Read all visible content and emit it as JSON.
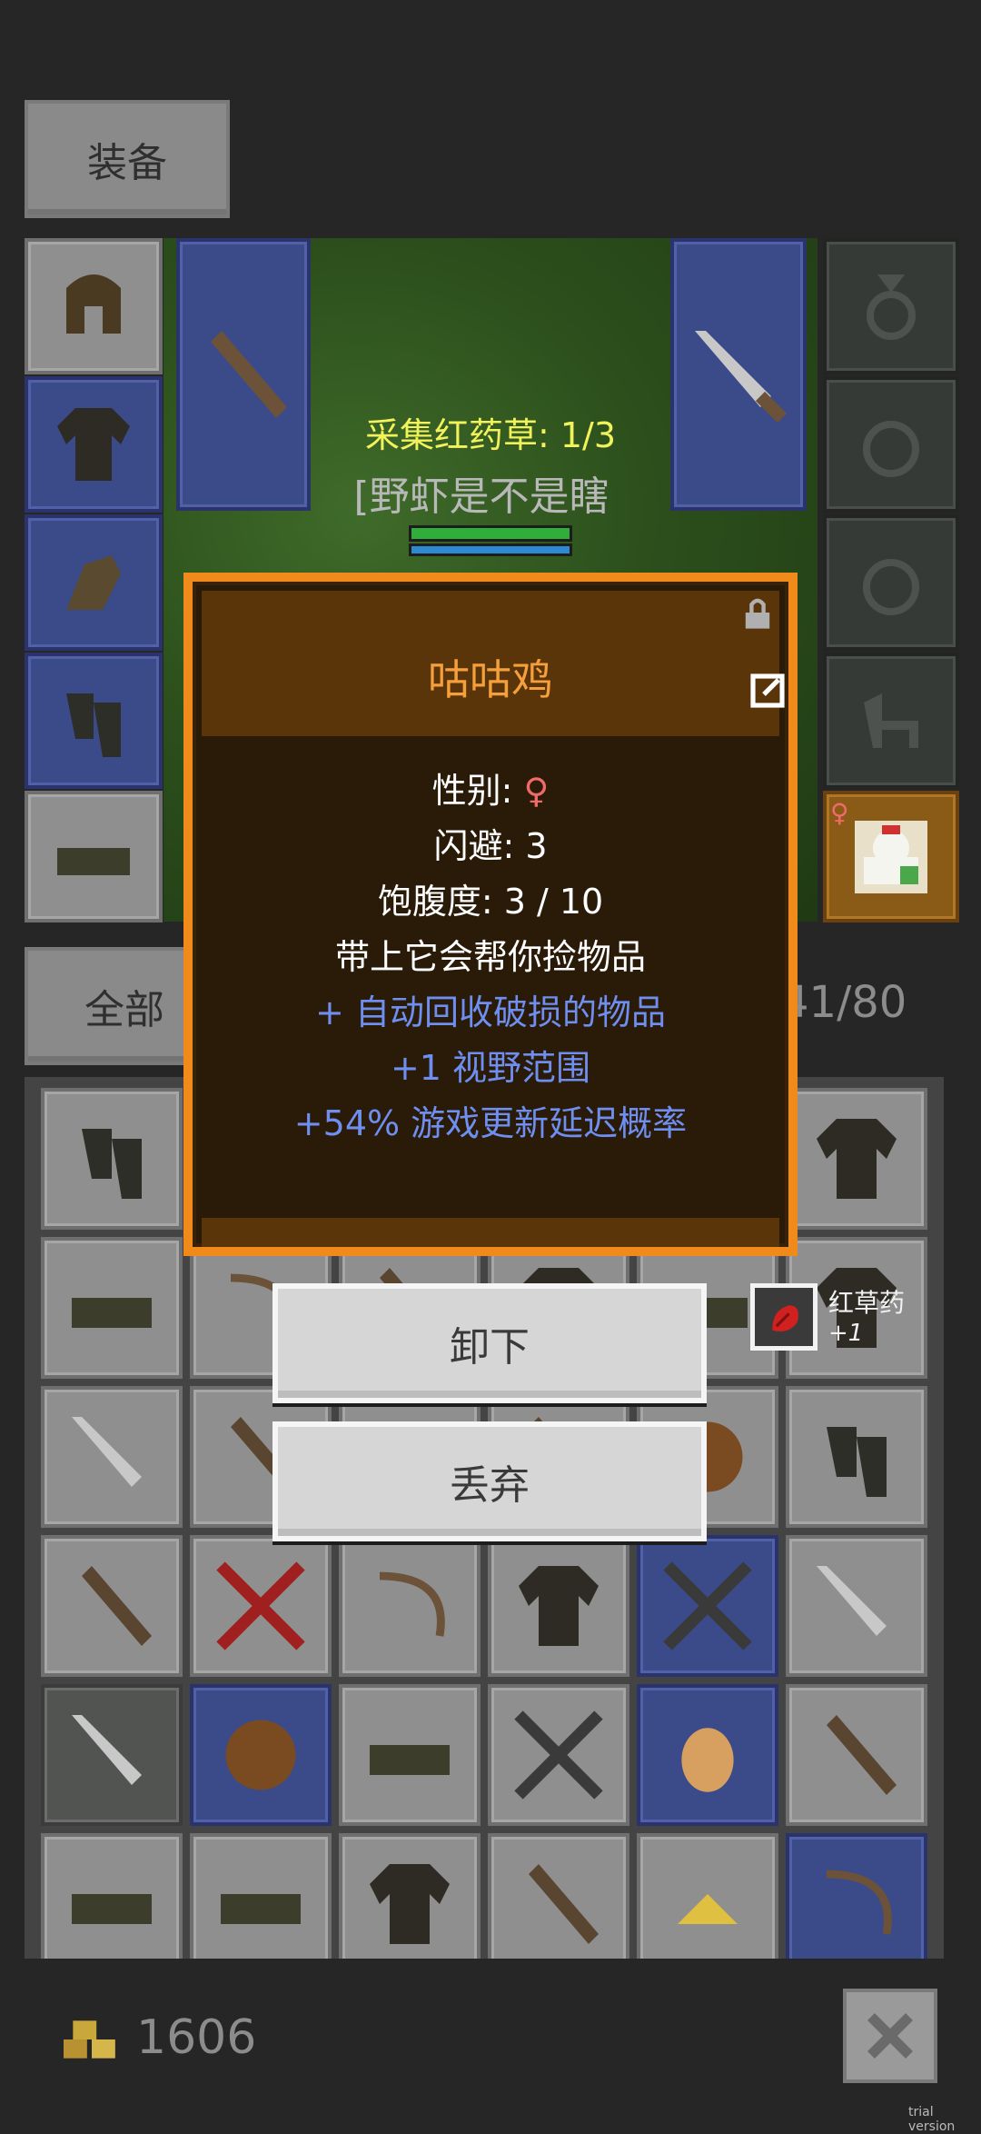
{
  "header": {
    "equip_tab": "装备"
  },
  "quest": {
    "text": "采集红药草: 1/3"
  },
  "player": {
    "name": "[野虾是不是瞎"
  },
  "inventory": {
    "all_tab": "全部",
    "count": "41/80"
  },
  "pet_popup": {
    "title": "咕咕鸡",
    "gender_label": "性别: ",
    "gender_symbol": "♀",
    "dodge": "闪避: 3",
    "satiety": "饱腹度: 3 / 10",
    "desc": "带上它会帮你捡物品",
    "bonus1": "+ 自动回收破损的物品",
    "bonus2": "+1 视野范围",
    "bonus3": "+54% 游戏更新延迟概率"
  },
  "actions": {
    "unequip": "卸下",
    "discard": "丢弃"
  },
  "pickup": {
    "item_name": "红草药",
    "amount": "+1"
  },
  "footer": {
    "gold": "1606"
  },
  "watermark": "trial version",
  "colors": {
    "popup_border": "#f08a1a",
    "popup_title": "#f5a03c",
    "quest_text": "#f2f25a",
    "bonus_text": "#6e8ef0",
    "gender_female": "#f06a6a"
  }
}
